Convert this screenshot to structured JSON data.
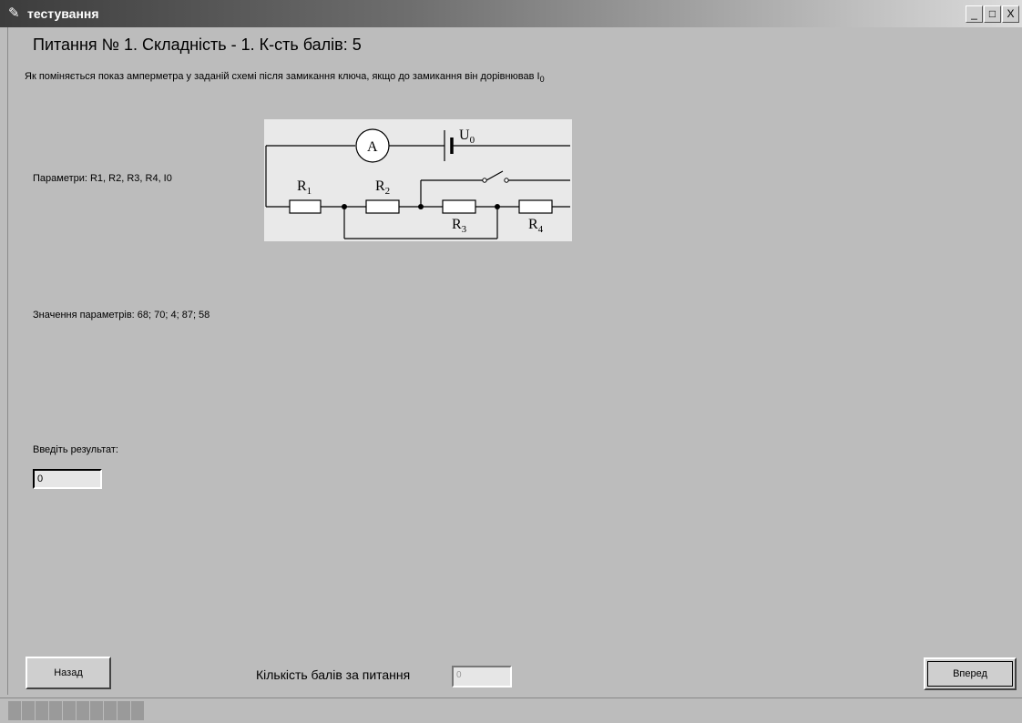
{
  "window": {
    "title": "тестування",
    "icon": "app-logo-icon",
    "controls": {
      "minimize": "_",
      "maximize": "□",
      "close": "X"
    }
  },
  "question": {
    "header": "Питання № 1. Складність - 1. К-сть балів: 5",
    "text": "Як поміняється показ амперметра у заданій схемі після замикання ключа, якщо до замикання він дорівнював I",
    "text_subscript": "0",
    "parameters": "Параметри: R1, R2, R3, R4, I0",
    "values": "Значення параметрів: 68; 70; 4; 87; 58"
  },
  "circuit": {
    "ammeter": "A",
    "source": "U",
    "source_sub": "0",
    "resistors": [
      {
        "label": "R",
        "sub": "1"
      },
      {
        "label": "R",
        "sub": "2"
      },
      {
        "label": "R",
        "sub": "3"
      },
      {
        "label": "R",
        "sub": "4"
      }
    ]
  },
  "answer": {
    "label": "Введіть результат:",
    "value": "0"
  },
  "footer": {
    "back_label": "Назад",
    "next_label": "Вперед",
    "score_label": "Кількість балів за питання",
    "score_value": "0"
  },
  "statusbar": {
    "progress_segments": 10
  }
}
